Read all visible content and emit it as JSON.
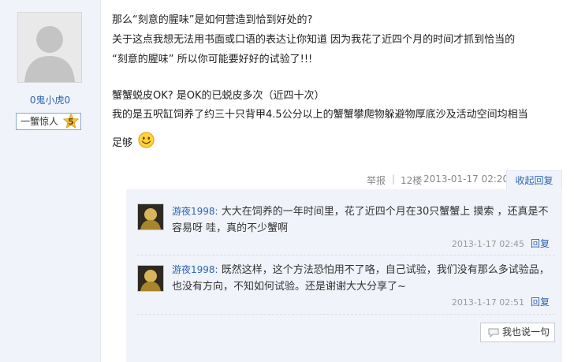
{
  "author": {
    "name": "0鬼小虎0",
    "rank_label": "一蟹惊人",
    "rank_level": "5"
  },
  "post": {
    "lines": [
      "那么“刻意的腥味”是如何营造到恰到好处的?",
      "关于这点我想无法用书面或口语的表达让你知道 因为我花了近四个月的时间才抓到恰当的",
      "“刻意的腥味” 所以你可能要好好的试验了!!!",
      "蟹蟹蜕皮OK? 是OK的已蜕皮多次（近四十次）",
      "我的是五呎缸饲养了约三十只背甲4.5公分以上的蟹蟹攀爬物躲避物厚底沙及活动空间均相当",
      "足够"
    ],
    "emoticon": "smile-emoticon"
  },
  "post_meta": {
    "report": "举报",
    "separator": "|",
    "floor": "12楼",
    "time": "2013-01-17 02:20",
    "fold_reply": "收起回复"
  },
  "replies": [
    {
      "user": "游夜1998",
      "colon": ":",
      "text": "大大在饲养的一年时间里，花了近四个月在30只蟹蟹上 摸索 ，还真是不容易呀 哇，真的不少蟹啊",
      "time": "2013-1-17 02:45",
      "reply_label": "回复"
    },
    {
      "user": "游夜1998",
      "colon": ":",
      "text": "既然这样，这个方法恐怕用不了咯，自己试验，我们没有那么多试验品，也没有方向，不知如何试验。还是谢谢大大分享了~",
      "time": "2013-1-17 02:51",
      "reply_label": "回复"
    }
  ],
  "say_button": "我也说一句",
  "colors": {
    "link": "#2d64b3",
    "sidebar_bg": "#f0f3f9",
    "reply_bg": "#f0f3f9"
  }
}
